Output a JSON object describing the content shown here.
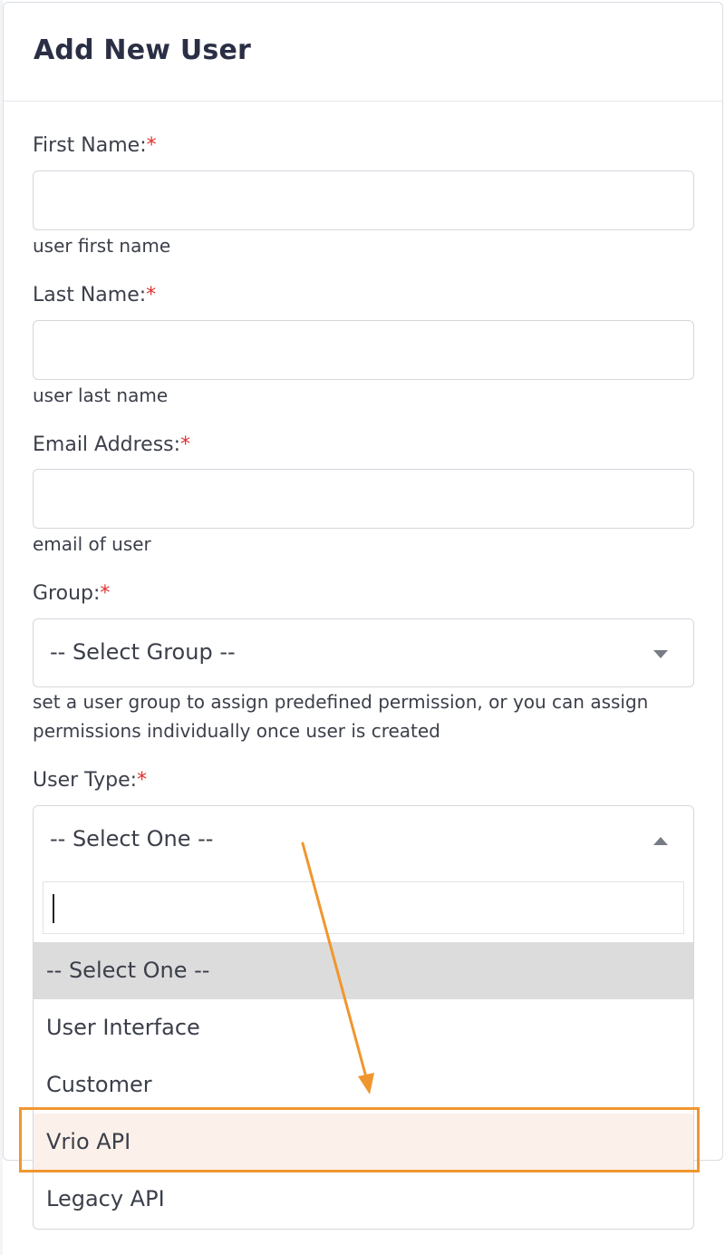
{
  "modal": {
    "title": "Add New User"
  },
  "form": {
    "required_mark": "*",
    "first_name": {
      "label": "First Name:",
      "value": "",
      "help": "user first name"
    },
    "last_name": {
      "label": "Last Name:",
      "value": "",
      "help": "user last name"
    },
    "email": {
      "label": "Email Address:",
      "value": "",
      "help": "email of user"
    },
    "group": {
      "label": "Group:",
      "selected": "-- Select Group --",
      "help": "set a user group to assign predefined permission, or you can assign permissions individually once user is created"
    },
    "user_type": {
      "label": "User Type:",
      "selected": "-- Select One --",
      "search_value": "",
      "options": [
        "-- Select One --",
        "User Interface",
        "Customer",
        "Vrio API",
        "Legacy API"
      ]
    }
  },
  "annotation": {
    "highlight_color": "#f0962e",
    "highlighted_option": "Vrio API"
  }
}
